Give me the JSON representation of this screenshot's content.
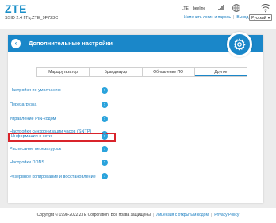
{
  "header": {
    "logo": "ZTE",
    "ssid": "SSID 2.4 ГГц:ZTE_9F723C",
    "network_type": "LTE",
    "operator": "beeline",
    "links": [
      "Изменить логин и пароль",
      "Выход"
    ],
    "language": "Русский"
  },
  "panel": {
    "title": "Дополнительные настройки",
    "tabs": [
      "Маршрутизатор",
      "Брандмауэр",
      "Обновление ПО",
      "Другое"
    ],
    "active_tab": "Другое",
    "items": [
      "Настройки по умолчанию",
      "Перезагрузка",
      "Управление PIN-кодом",
      "Настройки синхронизации часов (SNTP)",
      "Информация о сети",
      "Расписание перезагрузок",
      "Настройки DDNS",
      "Резервное копирование и восстановление"
    ],
    "highlighted_item": "Информация о сети",
    "highlight_color": "#d9242b",
    "accent_color": "#1a87c9"
  },
  "footer": {
    "copyright": "Copyright © 1998-2022 ZTE Corporation. Все права защищены",
    "links": [
      "Лицензия с открытым кодом",
      "Privacy Policy"
    ]
  }
}
